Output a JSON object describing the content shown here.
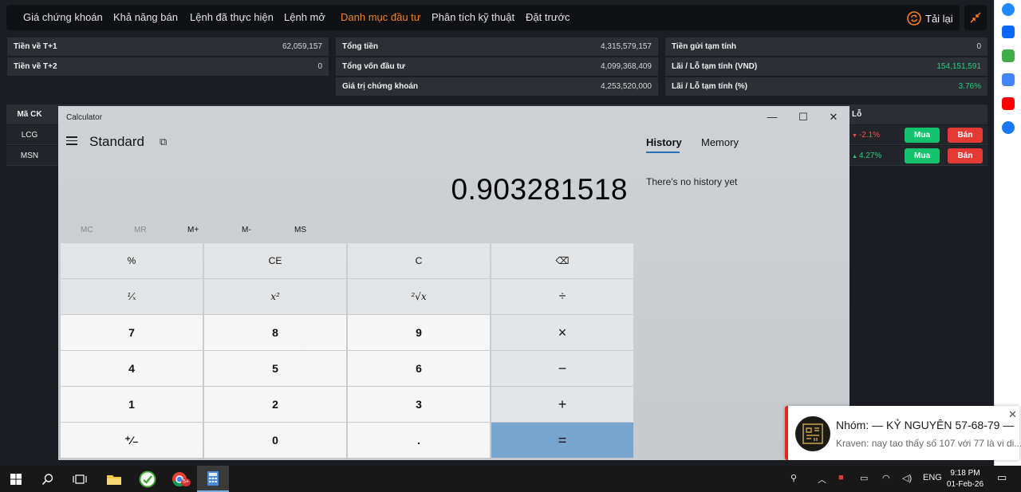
{
  "app": {
    "tabs": [
      "Giá chứng khoán",
      "Khả năng bán",
      "Lệnh đã thực hiện",
      "Lệnh mở",
      "Danh mục đầu tư",
      "Phân tích kỹ thuật",
      "Đặt trước"
    ],
    "active_tab": "Danh mục đầu tư",
    "reload_label": "Tải lại",
    "summary": {
      "col1": [
        {
          "label": "Tiền về T+1",
          "value": "62,059,157"
        },
        {
          "label": "Tiền về T+2",
          "value": "0"
        }
      ],
      "col2": [
        {
          "label": "Tổng tiền",
          "value": "4,315,579,157"
        },
        {
          "label": "Tổng vốn đầu tư",
          "value": "4,099,368,409"
        },
        {
          "label": "Giá trị chứng khoán",
          "value": "4,253,520,000"
        }
      ],
      "col3": [
        {
          "label": "Tiền gửi tạm tính",
          "value": "0"
        },
        {
          "label": "Lãi / Lỗ tạm tính (VND)",
          "value": "154,151,591"
        },
        {
          "label": "Lãi / Lỗ tạm tính (%)",
          "value": "3.76%"
        }
      ]
    },
    "table": {
      "header_symbol": "Mã CK",
      "header_pl": "Lỗ",
      "rows": [
        {
          "symbol": "LCG",
          "pct": "-2.1%",
          "buy": "Mua",
          "sell": "Bán"
        },
        {
          "symbol": "MSN",
          "pct": "4.27%",
          "buy": "Mua",
          "sell": "Bán"
        }
      ]
    }
  },
  "calculator": {
    "window_title": "Calculator",
    "mode": "Standard",
    "display": "0.903281518",
    "memory_buttons": [
      "MC",
      "MR",
      "M+",
      "M-",
      "MS"
    ],
    "keys": [
      [
        "%",
        "CE",
        "C",
        "⌫"
      ],
      [
        "¹⁄ₓ",
        "x²",
        "²√x",
        "÷"
      ],
      [
        "7",
        "8",
        "9",
        "×"
      ],
      [
        "4",
        "5",
        "6",
        "−"
      ],
      [
        "1",
        "2",
        "3",
        "+"
      ],
      [
        "⁺⁄₋",
        "0",
        ".",
        "="
      ]
    ],
    "side_tabs": [
      "History",
      "Memory"
    ],
    "history_empty": "There's no history yet"
  },
  "notification": {
    "title": "Nhóm: — KỶ NGUYÊN 57-68-79 —",
    "message": "Kraven: nay tao thấy số 107 với 77 là vi di..."
  },
  "taskbar": {
    "lang": "ENG",
    "time": "9:18 PM",
    "date": "01-Feb-26",
    "chrome_badge": "5+"
  },
  "colors": {
    "accent_orange": "#f5821f",
    "profit_green": "#26d07c",
    "loss_red": "#ff4d4d",
    "equals_blue": "#76a5cf"
  }
}
